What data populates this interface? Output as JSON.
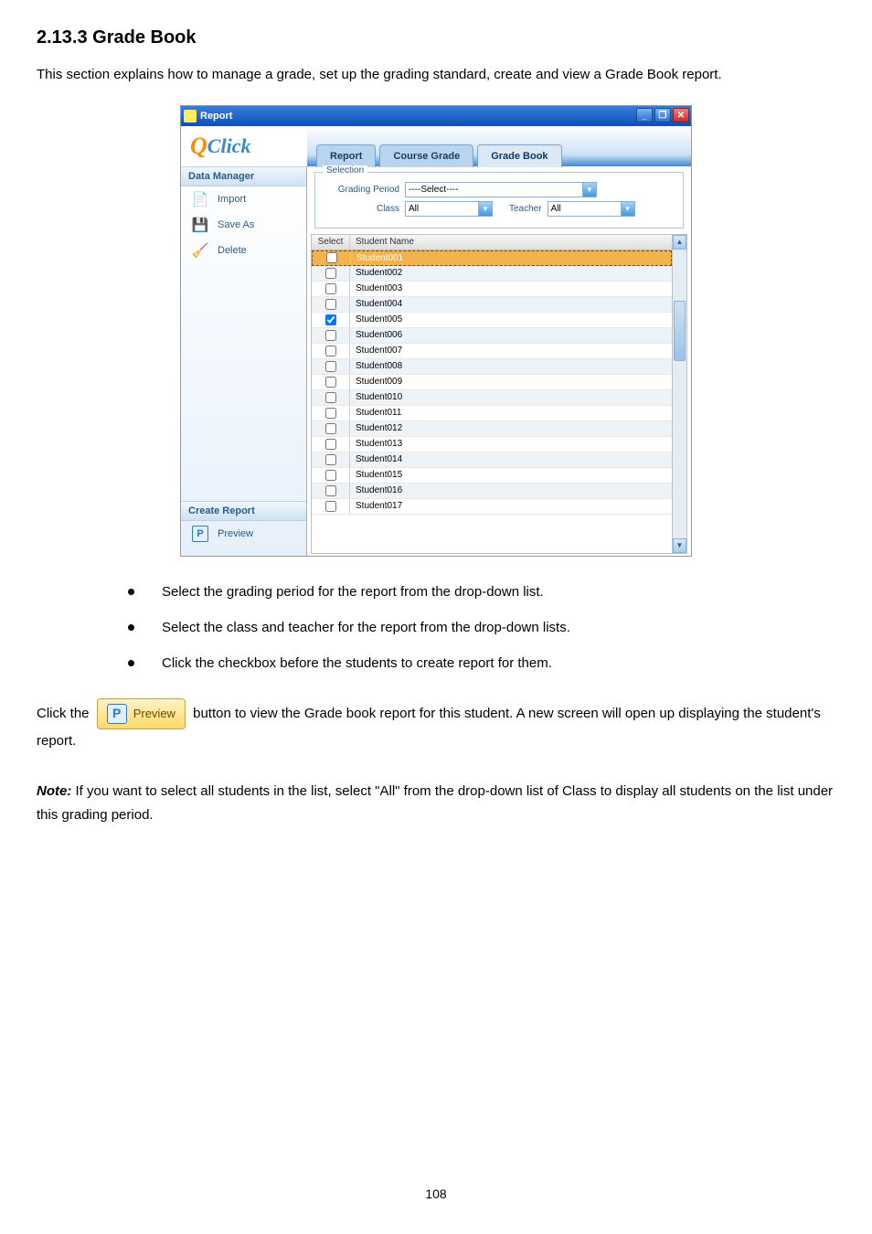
{
  "doc": {
    "heading": "2.13.3 Grade Book",
    "intro": "This section explains how to manage a grade, set up the grading standard, create and view a Grade Book report.",
    "bullets": [
      "Select the grading period for the report from the drop-down list.",
      "Select the class and teacher for the report from the drop-down lists.",
      "Click the checkbox before the students to create report for them."
    ],
    "p_before_btn": "Click the",
    "p_after_btn": "button to view the Grade book report for this student. A new screen will open up displaying the student's report.",
    "note_label": "Note:",
    "note_text": "If you want to select all students in the list, select \"All\" from the drop-down list of Class to display all students on the list under this grading period.",
    "page_number": "108"
  },
  "window": {
    "title": "Report",
    "logo": "Click",
    "tabs": {
      "report": "Report",
      "course": "Course Grade",
      "gradebook": "Grade Book"
    },
    "minimize": "_",
    "maximize": "❐",
    "close": "✕"
  },
  "left": {
    "data_manager": "Data Manager",
    "import": "Import",
    "saveas": "Save As",
    "delete": "Delete",
    "create_report": "Create Report",
    "preview": "Preview"
  },
  "selection": {
    "legend": "Selection",
    "grading_period_label": "Grading Period",
    "grading_period_value": "----Select----",
    "class_label": "Class",
    "class_value": "All",
    "teacher_label": "Teacher",
    "teacher_value": "All"
  },
  "table": {
    "col_select": "Select",
    "col_name": "Student Name",
    "rows": [
      {
        "name": "Student001",
        "checked": false,
        "selected": true
      },
      {
        "name": "Student002",
        "checked": false
      },
      {
        "name": "Student003",
        "checked": false
      },
      {
        "name": "Student004",
        "checked": false
      },
      {
        "name": "Student005",
        "checked": true
      },
      {
        "name": "Student006",
        "checked": false
      },
      {
        "name": "Student007",
        "checked": false
      },
      {
        "name": "Student008",
        "checked": false
      },
      {
        "name": "Student009",
        "checked": false
      },
      {
        "name": "Student010",
        "checked": false
      },
      {
        "name": "Student011",
        "checked": false
      },
      {
        "name": "Student012",
        "checked": false
      },
      {
        "name": "Student013",
        "checked": false
      },
      {
        "name": "Student014",
        "checked": false
      },
      {
        "name": "Student015",
        "checked": false
      },
      {
        "name": "Student016",
        "checked": false
      },
      {
        "name": "Student017",
        "checked": false
      }
    ]
  },
  "preview_btn": {
    "label": "Preview",
    "icon_letter": "P"
  }
}
